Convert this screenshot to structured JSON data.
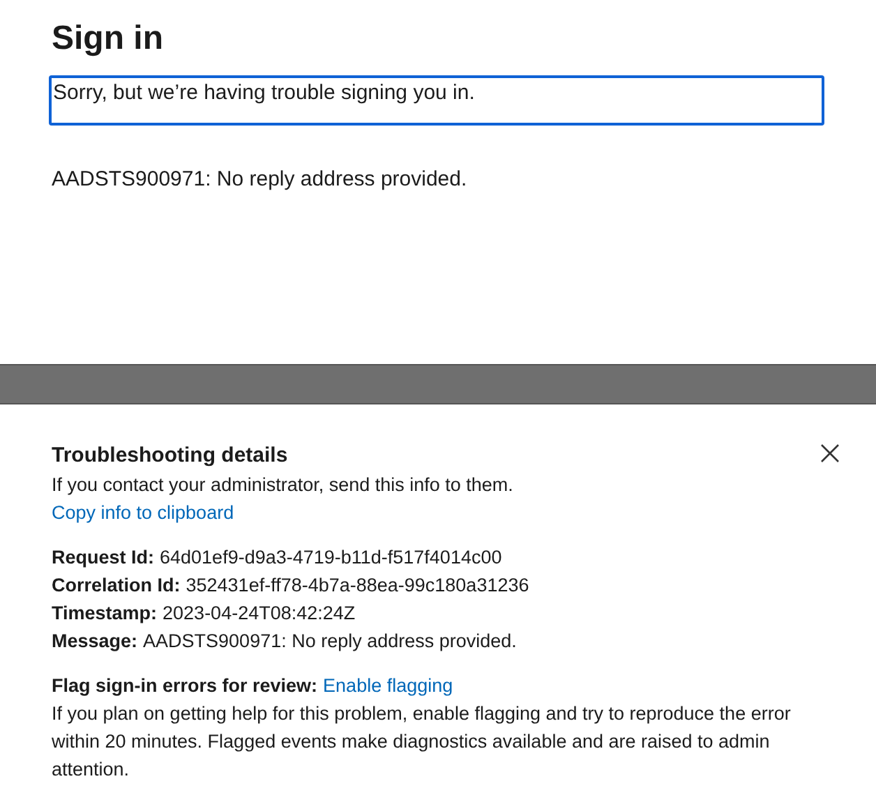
{
  "title": "Sign in",
  "message_box": {
    "text": "Sorry, but we’re having trouble signing you in."
  },
  "error_text": "AADSTS900971: No reply address provided.",
  "troubleshooting": {
    "title": "Troubleshooting details",
    "intro": "If you contact your administrator, send this info to them.",
    "copy_link": "Copy info to clipboard",
    "details": [
      {
        "label": "Request Id:",
        "value": "64d01ef9-d9a3-4719-b11d-f517f4014c00"
      },
      {
        "label": "Correlation Id:",
        "value": "352431ef-ff78-4b7a-88ea-99c180a31236"
      },
      {
        "label": "Timestamp:",
        "value": "2023-04-24T08:42:24Z"
      },
      {
        "label": "Message:",
        "value": "AADSTS900971: No reply address provided."
      }
    ],
    "flag_label": "Flag sign-in errors for review:",
    "flag_link": "Enable flagging",
    "flag_description": "If you plan on getting help for this problem, enable flagging and try to reproduce the error within 20 minutes. Flagged events make diagnostics available and are raised to admin attention."
  }
}
